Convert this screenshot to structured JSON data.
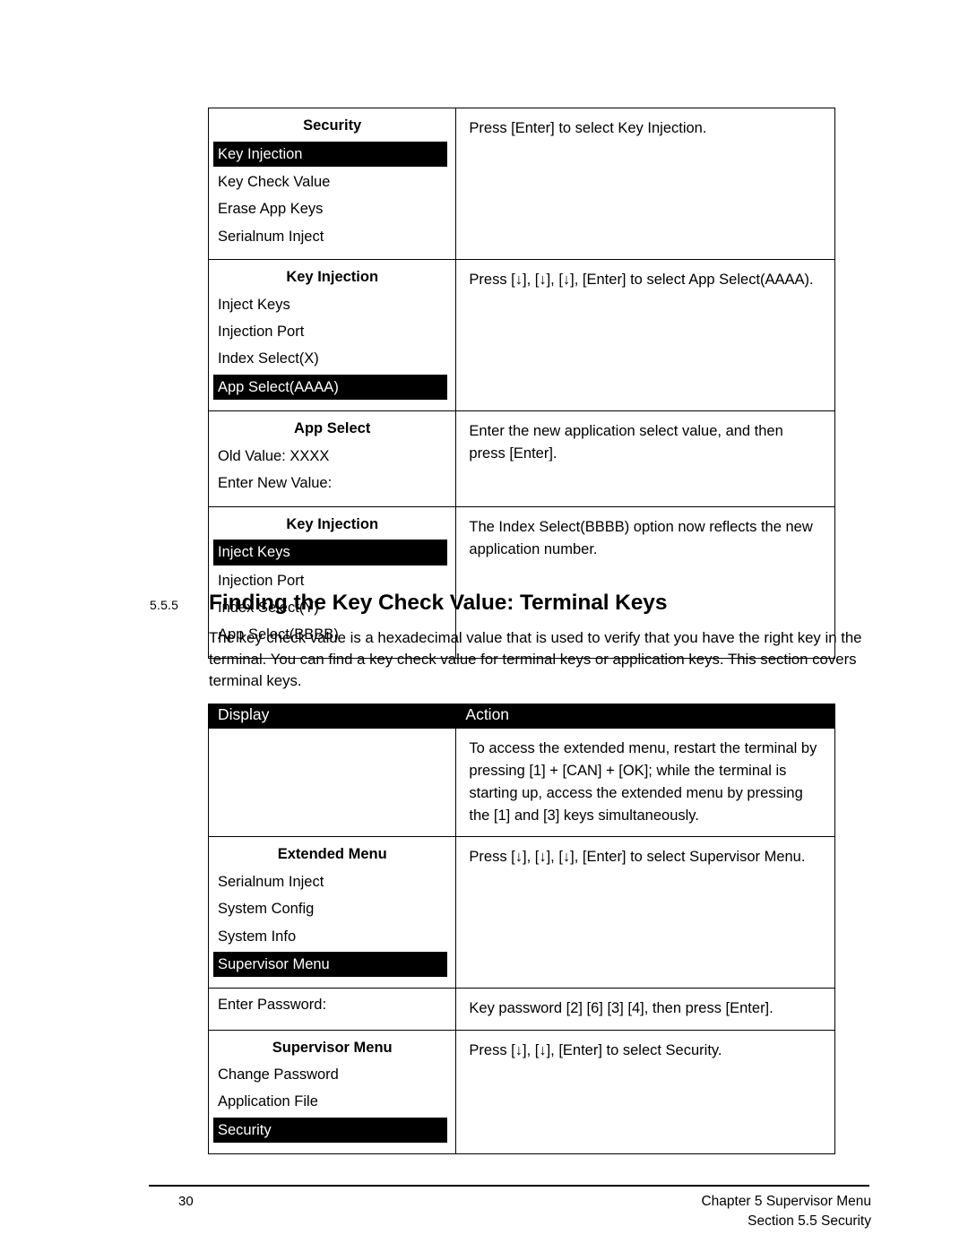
{
  "table_key_injection": {
    "rows": [
      {
        "display": {
          "title": "Security",
          "items": [
            {
              "label": "Key Injection",
              "selected": true
            },
            {
              "label": "Key Check Value",
              "selected": false
            },
            {
              "label": "Erase App Keys",
              "selected": false
            },
            {
              "label": "Serialnum Inject",
              "selected": false
            }
          ]
        },
        "action": "Press [Enter] to select Key Injection."
      },
      {
        "display": {
          "title": "Key Injection",
          "items": [
            {
              "label": "Inject Keys",
              "selected": false
            },
            {
              "label": "Injection Port",
              "selected": false
            },
            {
              "label": "Index Select(X)",
              "selected": false
            },
            {
              "label": "App Select(AAAA)",
              "selected": true
            }
          ]
        },
        "action": "Press [↓], [↓], [↓], [Enter] to select App Select(AAAA)."
      },
      {
        "display": {
          "title": "App Select",
          "items": [
            {
              "label": "Old Value: XXXX",
              "selected": false
            },
            {
              "label": "Enter New Value:",
              "selected": false
            }
          ]
        },
        "action": "Enter the new application select value, and then press [Enter]."
      },
      {
        "display": {
          "title": "Key Injection",
          "items": [
            {
              "label": "Inject Keys",
              "selected": true
            },
            {
              "label": "Injection Port",
              "selected": false
            },
            {
              "label": "Index Select(Y)",
              "selected": false
            },
            {
              "label": "App Select(BBBB)",
              "selected": false
            }
          ]
        },
        "action": "The Index Select(BBBB) option now reflects the new application number."
      }
    ]
  },
  "section": {
    "number": "5.5.5",
    "heading": "Finding the Key Check Value: Terminal Keys",
    "body": "The key check value is a hexadecimal value that is used to verify that you have the right key in the terminal. You can find a key check value for terminal keys or application keys. This section covers terminal keys."
  },
  "table_terminal_keys": {
    "headers": {
      "display": "Display",
      "action": "Action"
    },
    "rows": [
      {
        "display": {
          "title": "",
          "items": []
        },
        "action": "To access the extended menu, restart the terminal by pressing [1] + [CAN] + [OK]; while the terminal is starting up, access the extended menu by pressing the [1] and [3] keys simultaneously."
      },
      {
        "display": {
          "title": "Extended Menu",
          "items": [
            {
              "label": "Serialnum Inject",
              "selected": false
            },
            {
              "label": "System Config",
              "selected": false
            },
            {
              "label": "System Info",
              "selected": false
            },
            {
              "label": "Supervisor Menu",
              "selected": true
            }
          ]
        },
        "action": "Press [↓], [↓], [↓], [Enter] to select Supervisor Menu."
      },
      {
        "display": {
          "title": "",
          "items": [
            {
              "label": "Enter Password:",
              "selected": false
            }
          ]
        },
        "action": "Key password [2] [6] [3] [4], then press [Enter]."
      },
      {
        "display": {
          "title": "Supervisor Menu",
          "items": [
            {
              "label": "Change Password",
              "selected": false
            },
            {
              "label": "Application File",
              "selected": false
            },
            {
              "label": "Security",
              "selected": true
            }
          ]
        },
        "action": "Press [↓], [↓], [Enter] to select Security."
      }
    ]
  },
  "footer": {
    "page_number": "30",
    "chapter": "Chapter 5 Supervisor Menu",
    "section": "Section 5.5 Security"
  }
}
